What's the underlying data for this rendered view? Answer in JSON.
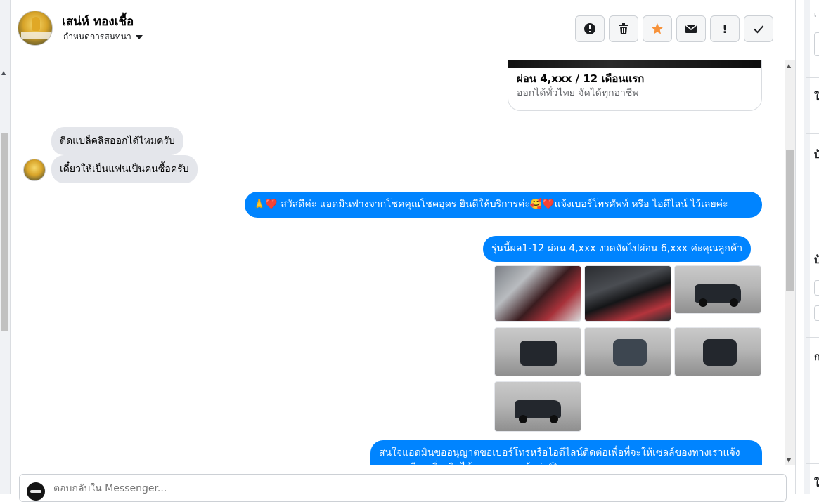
{
  "contact": {
    "name": "เสน่ห์ ทองเชื้อ",
    "subtitle": "กำหนดการสนทนา"
  },
  "toolbar": {
    "buttons": [
      {
        "icon": "info-circle-icon"
      },
      {
        "icon": "trash-icon"
      },
      {
        "icon": "star-icon",
        "color": "#f7923a"
      },
      {
        "icon": "envelope-icon"
      },
      {
        "icon": "exclamation-icon",
        "label": "!"
      },
      {
        "icon": "check-icon"
      }
    ]
  },
  "thread": {
    "link_card": {
      "title": "ผ่อน 4,xxx / 12 เดือนแรก",
      "subtitle": "ออกได้ทั่วไทย จัดได้ทุกอาชีพ"
    },
    "incoming": [
      "ติดแบล็คลิสออกได้ไหมครับ",
      "เดี๋ยวให้เป็นแฟนเป็นคนซื้อครับ"
    ],
    "outgoing": [
      "🙏❤️ สวัสดีค่ะ แอดมินฟางจากโชคคุณโชคอุดร ยินดีให้บริการค่ะ🥰❤️แจ้งเบอร์โทรศัพท์ หรือ ไอดีไลน์  ไว้เลยค่ะ",
      "รุ่นนี้ผล1-12 ผ่อน 4,xxx งวดถัดไปผ่อน  6,xxx ค่ะคุณลูกค้า",
      "สนใจแอดมินขออนุญาตขอเบอร์โทรหรือไอดีไลน์ติดต่อเพื่อที่จะให้เซลล์ของทางเราแจ้งรายละเอียดเพิ่มเติมได้นะคะคุณลูกค้าค่ะ😊"
    ],
    "photo_count": 7
  },
  "composer": {
    "placeholder": "ตอบกลับใน Messenger..."
  },
  "right_panel": {
    "headers": [
      "เ",
      "ใ",
      "บ้",
      "บ้",
      "ก",
      "ใ"
    ]
  },
  "colors": {
    "outgoing_bubble": "#0084ff",
    "incoming_bubble": "#e4e6eb"
  }
}
